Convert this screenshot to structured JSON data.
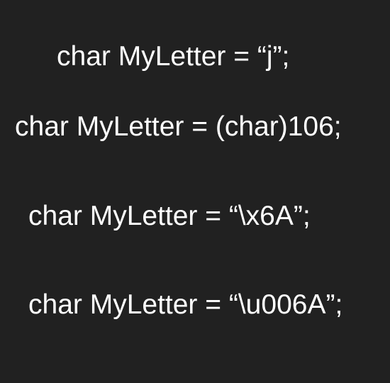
{
  "background_color": "#212121",
  "text_color": "#ffffff",
  "lines": [
    "char MyLetter = “j”;",
    "char MyLetter = (char)106;",
    "char MyLetter = “\\x6A”;",
    "char MyLetter = “\\u006A”;"
  ]
}
